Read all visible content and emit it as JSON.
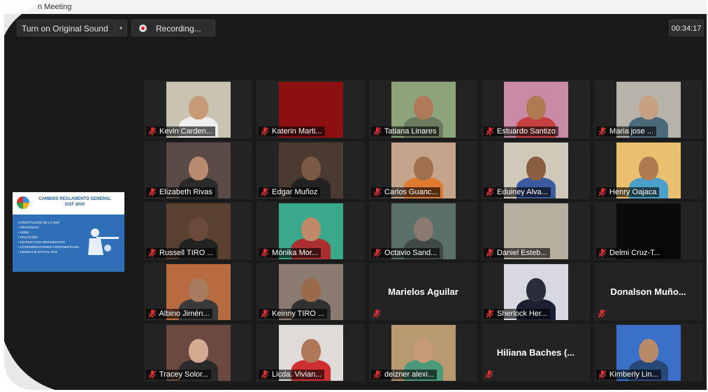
{
  "window": {
    "title": "n Meeting"
  },
  "toolbar": {
    "sound_label": "Turn on Original Sound",
    "dropdown_glyph": "▾",
    "recording_label": "Recording...",
    "timer": "00:34:17"
  },
  "shared_content": {
    "title": "CAMBIOS REGLAMENTO GENERAL ISSF 2020",
    "items": [
      "CONSTITUCIÓN DE LA ISSF",
      "• PROPÓSITO",
      "• SEDE",
      "• AFILIACIÓN",
      "• ESTRUCTURA ORGANIZATIVA",
      "• CONFEDERACIONES CONTINENTALES",
      "• LENGUAJE OFICIAL ISSF"
    ]
  },
  "participants": [
    {
      "name": "Kevin Carden...",
      "video": true,
      "bg": "#c9c3b2",
      "skin": "#c79a78",
      "shirt": "#eeeeee"
    },
    {
      "name": "Katerin Marti...",
      "video": true,
      "bg": "#8c1010",
      "skin": "#8c1010",
      "shirt": "#8c1010"
    },
    {
      "name": "Tatiana Linares",
      "video": true,
      "bg": "#8da37a",
      "skin": "#b07a58",
      "shirt": "#6a7a60"
    },
    {
      "name": "Estuardo Santizo",
      "video": true,
      "bg": "#c98aa6",
      "skin": "#b07a52",
      "shirt": "#c84040"
    },
    {
      "name": "Maria jose ...",
      "video": true,
      "bg": "#b8b3a8",
      "skin": "#c6a082",
      "shirt": "#4a6a7a"
    },
    {
      "name": "Elizabeth Rivas",
      "video": true,
      "bg": "#5a4a48",
      "skin": "#b88a70",
      "shirt": "#2a2a2a"
    },
    {
      "name": "Edgar Muñoz",
      "video": true,
      "bg": "#4a3a30",
      "skin": "#7a5a45",
      "shirt": "#222222"
    },
    {
      "name": "Carlos Guanc...",
      "video": true,
      "bg": "#c4a48a",
      "skin": "#a0704e",
      "shirt": "#e07a30"
    },
    {
      "name": "Eduiney Alva...",
      "video": true,
      "bg": "#d0c8b8",
      "skin": "#8a5e40",
      "shirt": "#3a5aa0"
    },
    {
      "name": "Henry Oajaca",
      "video": true,
      "bg": "#e8c070",
      "skin": "#b07a50",
      "shirt": "#4aa0c8"
    },
    {
      "name": "Russell TIRO ...",
      "video": true,
      "bg": "#5a4030",
      "skin": "#6a4a38",
      "shirt": "#222222"
    },
    {
      "name": "Mónika Mor...",
      "video": true,
      "bg": "#3aa88a",
      "skin": "#c08a6a",
      "shirt": "#aa3030"
    },
    {
      "name": "Octavio Sand...",
      "video": true,
      "bg": "#5a7068",
      "skin": "#8a7a70",
      "shirt": "#404848"
    },
    {
      "name": "Daniel Esteb...",
      "video": true,
      "bg": "#b8aea0",
      "skin": "#b8aea0",
      "shirt": "#b8aea0"
    },
    {
      "name": "Delmi Cruz-T...",
      "video": true,
      "bg": "#0a0a0a",
      "skin": "#0a0a0a",
      "shirt": "#0a0a0a"
    },
    {
      "name": "Albino Jimén...",
      "video": true,
      "bg": "#b86a40",
      "skin": "#a87a60",
      "shirt": "#3a3a3a"
    },
    {
      "name": "Keinny TIRO ...",
      "video": true,
      "bg": "#8a7a70",
      "skin": "#9a6a4a",
      "shirt": "#303030"
    },
    {
      "name": "Marielos Aguilar",
      "video": false
    },
    {
      "name": "Sherlock Her...",
      "video": true,
      "bg": "#d8d8e0",
      "skin": "#2a2e3a",
      "shirt": "#1a2030"
    },
    {
      "name": "Donalson Muño...",
      "video": false
    },
    {
      "name": "Tracey Solor...",
      "video": true,
      "bg": "#6a4a40",
      "skin": "#d4aa90",
      "shirt": "#2a2a2a"
    },
    {
      "name": "Licda. Vivian...",
      "video": true,
      "bg": "#e0dad8",
      "skin": "#b07858",
      "shirt": "#cc3030"
    },
    {
      "name": "deizner alexi...",
      "video": true,
      "bg": "#b89a70",
      "skin": "#c89a78",
      "shirt": "#4a9a7a"
    },
    {
      "name": "Hiliana Baches (...",
      "video": false
    },
    {
      "name": "Kimberly Lin...",
      "video": true,
      "bg": "#3a70c8",
      "skin": "#b88a6a",
      "shirt": "#284878"
    }
  ],
  "colors": {
    "muted_mic": "#e03030",
    "window_bg": "#1a1a1a",
    "tile_bg": "#232323"
  }
}
